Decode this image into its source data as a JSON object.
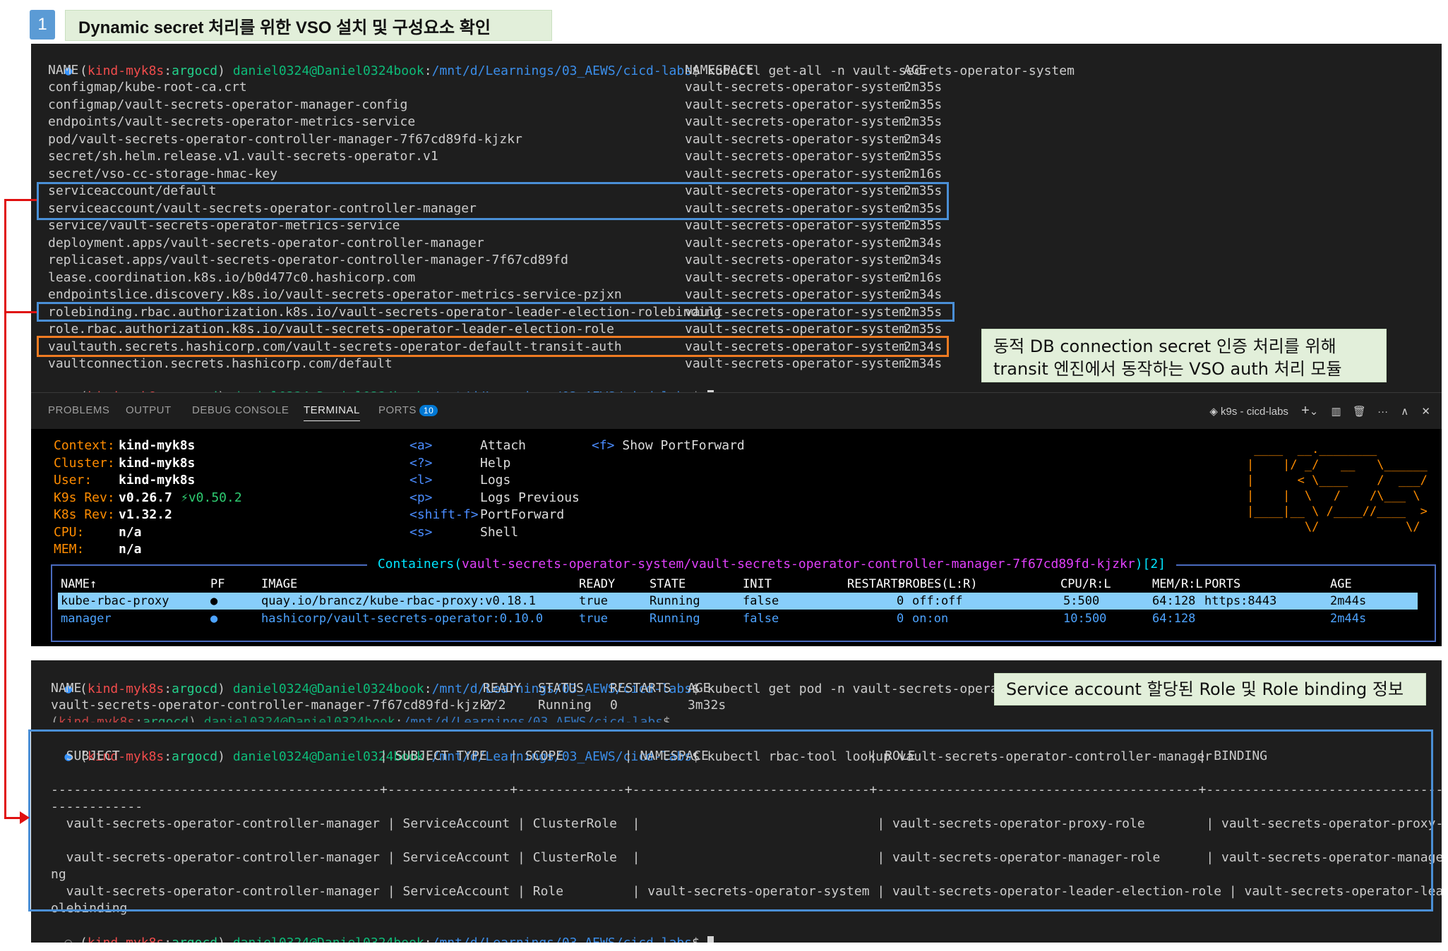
{
  "header": {
    "step": "1",
    "title": "Dynamic secret 처리를 위한 VSO 설치 및 구성요소 확인"
  },
  "prompt": {
    "env_open": "(",
    "env": "kind-myk8s",
    "sep": ":",
    "ns": "argocd",
    "env_close": ")",
    "user": "daniel0324@Daniel0324book",
    "colon": ":",
    "path": "/mnt/d/Learnings/03_AEWS/cicd-labs",
    "dollar": "$"
  },
  "terminal1": {
    "command": " kubectl get-all -n vault-secrets-operator-system",
    "headers": {
      "name": "NAME",
      "namespace": "NAMESPACE",
      "age": "AGE"
    },
    "rows": [
      {
        "name": "configmap/kube-root-ca.crt",
        "namespace": "vault-secrets-operator-system",
        "age": "2m35s"
      },
      {
        "name": "configmap/vault-secrets-operator-manager-config",
        "namespace": "vault-secrets-operator-system",
        "age": "2m35s"
      },
      {
        "name": "endpoints/vault-secrets-operator-metrics-service",
        "namespace": "vault-secrets-operator-system",
        "age": "2m35s"
      },
      {
        "name": "pod/vault-secrets-operator-controller-manager-7f67cd89fd-kjzkr",
        "namespace": "vault-secrets-operator-system",
        "age": "2m34s"
      },
      {
        "name": "secret/sh.helm.release.v1.vault-secrets-operator.v1",
        "namespace": "vault-secrets-operator-system",
        "age": "2m35s"
      },
      {
        "name": "secret/vso-cc-storage-hmac-key",
        "namespace": "vault-secrets-operator-system",
        "age": "2m16s"
      },
      {
        "name": "serviceaccount/default",
        "namespace": "vault-secrets-operator-system",
        "age": "2m35s"
      },
      {
        "name": "serviceaccount/vault-secrets-operator-controller-manager",
        "namespace": "vault-secrets-operator-system",
        "age": "2m35s"
      },
      {
        "name": "service/vault-secrets-operator-metrics-service",
        "namespace": "vault-secrets-operator-system",
        "age": "2m35s"
      },
      {
        "name": "deployment.apps/vault-secrets-operator-controller-manager",
        "namespace": "vault-secrets-operator-system",
        "age": "2m34s"
      },
      {
        "name": "replicaset.apps/vault-secrets-operator-controller-manager-7f67cd89fd",
        "namespace": "vault-secrets-operator-system",
        "age": "2m34s"
      },
      {
        "name": "lease.coordination.k8s.io/b0d477c0.hashicorp.com",
        "namespace": "vault-secrets-operator-system",
        "age": "2m16s"
      },
      {
        "name": "endpointslice.discovery.k8s.io/vault-secrets-operator-metrics-service-pzjxn",
        "namespace": "vault-secrets-operator-system",
        "age": "2m34s"
      },
      {
        "name": "rolebinding.rbac.authorization.k8s.io/vault-secrets-operator-leader-election-rolebinding",
        "namespace": "vault-secrets-operator-system",
        "age": "2m35s"
      },
      {
        "name": "role.rbac.authorization.k8s.io/vault-secrets-operator-leader-election-role",
        "namespace": "vault-secrets-operator-system",
        "age": "2m35s"
      },
      {
        "name": "vaultauth.secrets.hashicorp.com/vault-secrets-operator-default-transit-auth",
        "namespace": "vault-secrets-operator-system",
        "age": "2m34s"
      },
      {
        "name": "vaultconnection.secrets.hashicorp.com/default",
        "namespace": "vault-secrets-operator-system",
        "age": "2m34s"
      }
    ]
  },
  "panel": {
    "tabs": [
      "PROBLEMS",
      "OUTPUT",
      "DEBUG CONSOLE",
      "TERMINAL",
      "PORTS"
    ],
    "ports_count": "10",
    "terminal_name": "k9s - cicd-labs",
    "plus": "+",
    "chevron": "⌄",
    "more": "···",
    "up": "∧",
    "close": "✕"
  },
  "k9s": {
    "info": [
      {
        "label": "Context:",
        "value": "kind-myk8s"
      },
      {
        "label": "Cluster:",
        "value": "kind-myk8s"
      },
      {
        "label": "User:",
        "value": "kind-myk8s"
      },
      {
        "label": "K9s Rev:",
        "value": "v0.26.7",
        "extra": "⚡v0.50.2"
      },
      {
        "label": "K8s Rev:",
        "value": "v1.32.2"
      },
      {
        "label": "CPU:",
        "value": "n/a"
      },
      {
        "label": "MEM:",
        "value": "n/a"
      }
    ],
    "shortcuts": [
      {
        "key": "<a>",
        "action": "Attach"
      },
      {
        "key": "<?>",
        "action": "Help"
      },
      {
        "key": "<l>",
        "action": "Logs"
      },
      {
        "key": "<p>",
        "action": "Logs Previous"
      },
      {
        "key": "<shift-f>",
        "action": "PortForward"
      },
      {
        "key": "<s>",
        "action": "Shell"
      }
    ],
    "shortcut2": {
      "key": "<f>",
      "action": "Show PortForward"
    },
    "logo": [
      " ____  __.________       ",
      "|    |/ _/   __   \\______",
      "|      < \\____    /  ___/",
      "|    |  \\   /    /\\___ \\ ",
      "|____|__ \\ /____//____  >",
      "        \\/            \\/ "
    ],
    "containers_title_pre": " Containers(",
    "containers_title_path": "vault-secrets-operator-system/vault-secrets-operator-controller-manager-7f67cd89fd-kjzkr",
    "containers_title_post": ")[2] ",
    "columns": [
      "NAME↑",
      "PF",
      "IMAGE",
      "READY",
      "STATE",
      "INIT",
      "RESTARTS",
      "PROBES(L:R)",
      "CPU/R:L",
      "MEM/R:L",
      "PORTS",
      "AGE"
    ],
    "rows": [
      {
        "name": "kube-rbac-proxy",
        "pf": "●",
        "image": "quay.io/brancz/kube-rbac-proxy:v0.18.1",
        "ready": "true",
        "state": "Running",
        "init": "false",
        "restarts": "0",
        "probes": "off:off",
        "cpu": "5:500",
        "mem": "64:128",
        "ports": "https:8443",
        "age": "2m44s"
      },
      {
        "name": "manager",
        "pf": "●",
        "image": "hashicorp/vault-secrets-operator:0.10.0",
        "ready": "true",
        "state": "Running",
        "init": "false",
        "restarts": "0",
        "probes": "on:on",
        "cpu": "10:500",
        "mem": "64:128",
        "ports": "",
        "age": "2m44s"
      }
    ]
  },
  "terminal2": {
    "cmd1": " kubectl get pod -n vault-secrets-operator-system",
    "pod_header": {
      "name": "NAME",
      "ready": "READY",
      "status": "STATUS",
      "restarts": "RESTARTS",
      "age": "AGE"
    },
    "pod_row": {
      "name": "vault-secrets-operator-controller-manager-7f67cd89fd-kjzkr",
      "ready": "2/2",
      "status": "Running",
      "restarts": "0",
      "age": "3m32s"
    },
    "cmd2": " kubectl rbac-tool lookup vault-secrets-operator-controller-manager",
    "rbac_header": "  SUBJECT                                  | SUBJECT TYPE   | SCOPE        | NAMESPACE                     | ROLE                                     | BINDING",
    "divider": "-------------------------------------------+----------------+--------------+-------------------------------+------------------------------------------+--------------------------------------------",
    "divider2": "------------",
    "rbac_rows": [
      "  vault-secrets-operator-controller-manager | ServiceAccount | ClusterRole  |                               | vault-secrets-operator-proxy-role        | vault-secrets-operator-proxy-rolebinding",
      "  vault-secrets-operator-controller-manager | ServiceAccount | ClusterRole  |                               | vault-secrets-operator-manager-role      | vault-secrets-operator-manager-rolebindi",
      "ng",
      "  vault-secrets-operator-controller-manager | ServiceAccount | Role         | vault-secrets-operator-system | vault-secrets-operator-leader-election-role | vault-secrets-operator-leader-election-r",
      "olebinding"
    ]
  },
  "notes": {
    "transit_line1": "동적 DB connection secret 인증 처리를 위해",
    "transit_line2": "transit 엔진에서 동작하는 VSO auth 처리 모듈",
    "rbac": "Service account 할당된 Role 및 Role binding 정보"
  },
  "colors": {
    "terminal_bg": "#1e1e1e",
    "annotation_blue": "#4a8fd6",
    "annotation_orange": "#f07b22",
    "note_bg": "#e2efda",
    "arrow_red": "#e01010"
  }
}
